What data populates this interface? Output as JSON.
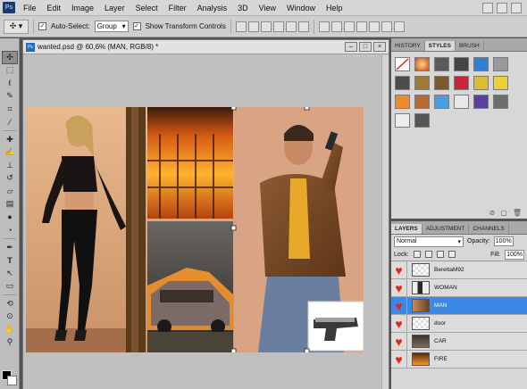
{
  "menu": {
    "items": [
      "File",
      "Edit",
      "Image",
      "Layer",
      "Select",
      "Filter",
      "Analysis",
      "3D",
      "View",
      "Window",
      "Help"
    ]
  },
  "options": {
    "auto_select_label": "Auto-Select:",
    "auto_select_value": "Group",
    "transform_label": "Show Transform Controls"
  },
  "document": {
    "title": "wanted.psd @ 60,6% (MAN, RGB/8) *"
  },
  "styles_panel": {
    "tabs": [
      "HISTORY",
      "STYLES",
      "BRUSH"
    ],
    "active_tab": "STYLES"
  },
  "layers_panel": {
    "tabs": [
      "LAYERS",
      "ADJUSTMENT",
      "CHANNELS"
    ],
    "blend_mode": "Normal",
    "opacity_label": "Opacity:",
    "opacity_value": "100%",
    "lock_label": "Lock:",
    "fill_label": "Fill:",
    "fill_value": "100%",
    "layers": [
      {
        "name": "BerettaM92",
        "selected": false
      },
      {
        "name": "WOMAN",
        "selected": false
      },
      {
        "name": "MAN",
        "selected": true
      },
      {
        "name": "door",
        "selected": false
      },
      {
        "name": "CAR",
        "selected": false
      },
      {
        "name": "FIRE",
        "selected": false
      }
    ]
  }
}
